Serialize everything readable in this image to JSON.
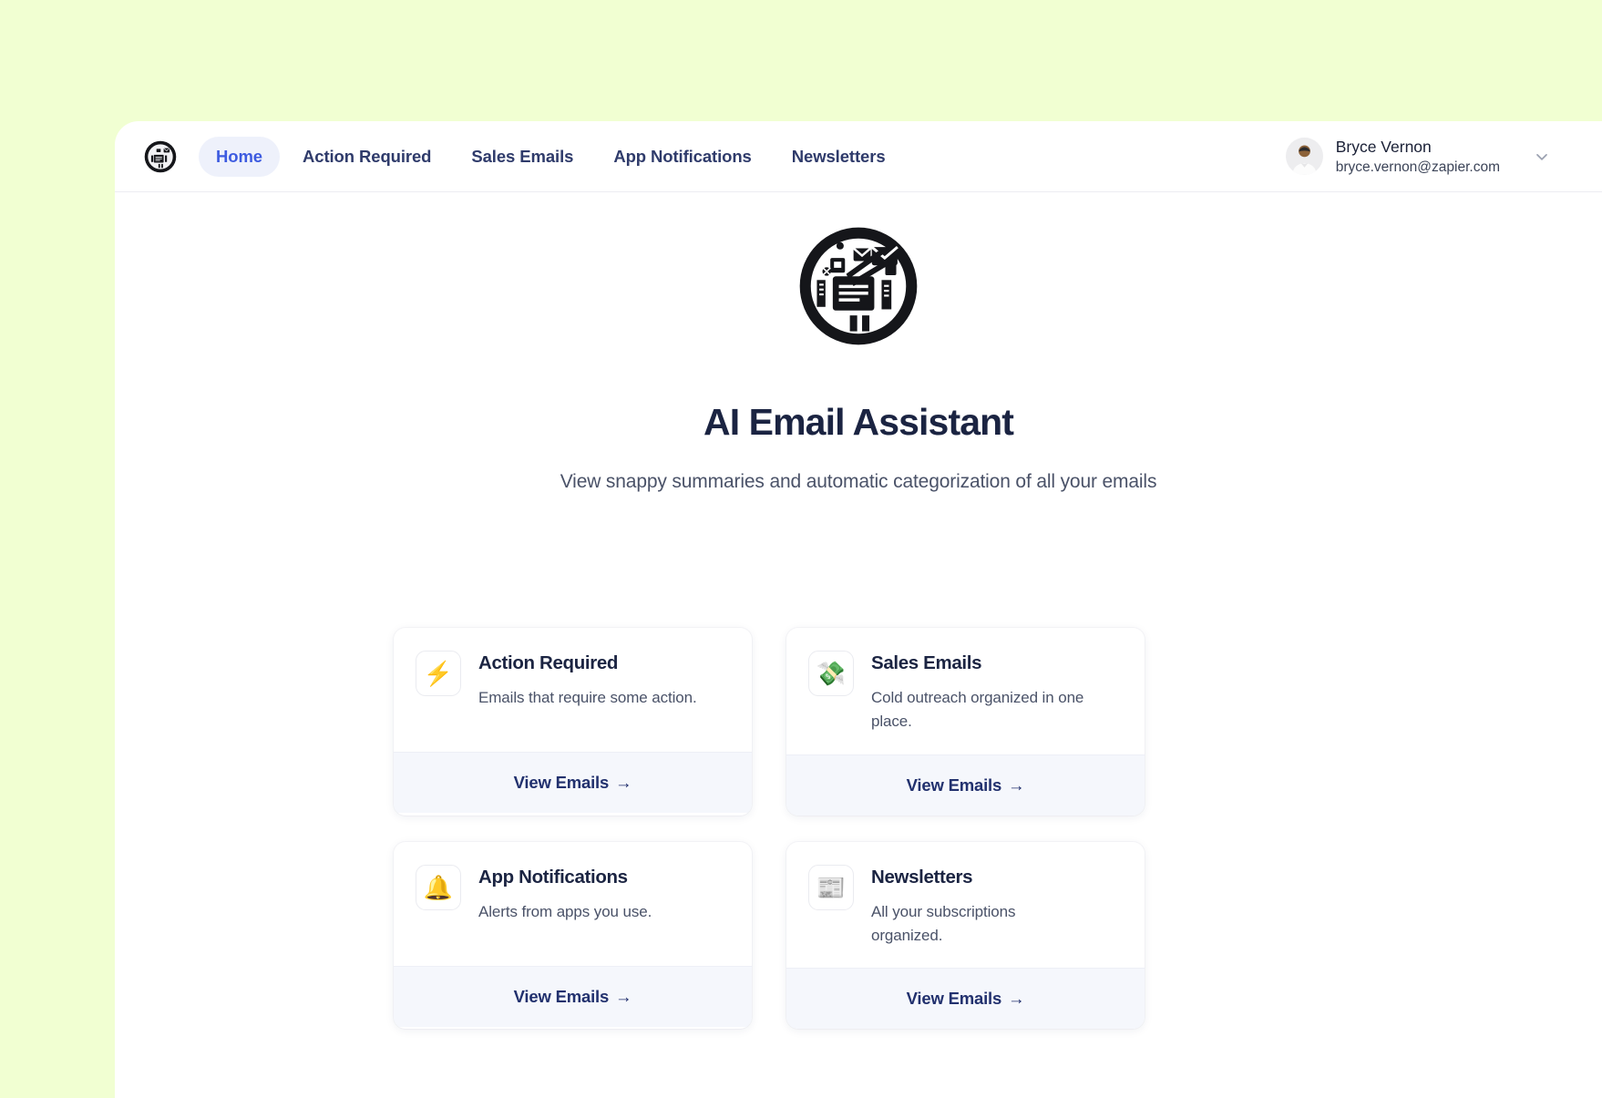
{
  "page": {
    "background_color": "#F1FFD2",
    "surface_color": "#FFFFFF"
  },
  "header": {
    "brand_logo_icon": "ai-email-assistant-logo-icon",
    "nav": [
      {
        "label": "Home",
        "active": true
      },
      {
        "label": "Action Required",
        "active": false
      },
      {
        "label": "Sales Emails",
        "active": false
      },
      {
        "label": "App Notifications",
        "active": false
      },
      {
        "label": "Newsletters",
        "active": false
      }
    ],
    "user": {
      "name": "Bryce Vernon",
      "email": "bryce.vernon@zapier.com",
      "avatar_icon": "user-avatar",
      "chevron_icon": "chevron-down-icon"
    },
    "active_pill_bg": "#EEF1FB",
    "active_pill_text": "#3D5BE0",
    "nav_text": "#2F3B6B"
  },
  "hero": {
    "logo_icon": "ai-email-assistant-logo-icon",
    "title": "AI Email Assistant",
    "subtitle": "View snappy summaries and automatic categorization of all your emails",
    "title_color": "#1B2442",
    "subtitle_color": "#4A5268"
  },
  "cards": [
    {
      "icon": "⚡",
      "icon_name": "lightning-bolt-icon",
      "title": "Action Required",
      "description": "Emails that require some action.",
      "cta": "View Emails",
      "cta_arrow": "→"
    },
    {
      "icon": "💸",
      "icon_name": "money-with-wings-icon",
      "title": "Sales Emails",
      "description": "Cold outreach organized in one place.",
      "cta": "View Emails",
      "cta_arrow": "→"
    },
    {
      "icon": "🔔",
      "icon_name": "bell-icon",
      "title": "App Notifications",
      "description": "Alerts from apps you use.",
      "cta": "View Emails",
      "cta_arrow": "→"
    },
    {
      "icon": "📰",
      "icon_name": "newspaper-icon",
      "title": "Newsletters",
      "description": "All your subscriptions organized.",
      "cta": "View Emails",
      "cta_arrow": "→"
    }
  ],
  "colors": {
    "card_footer_bg": "#F5F7FC",
    "cta_text": "#22316E"
  }
}
